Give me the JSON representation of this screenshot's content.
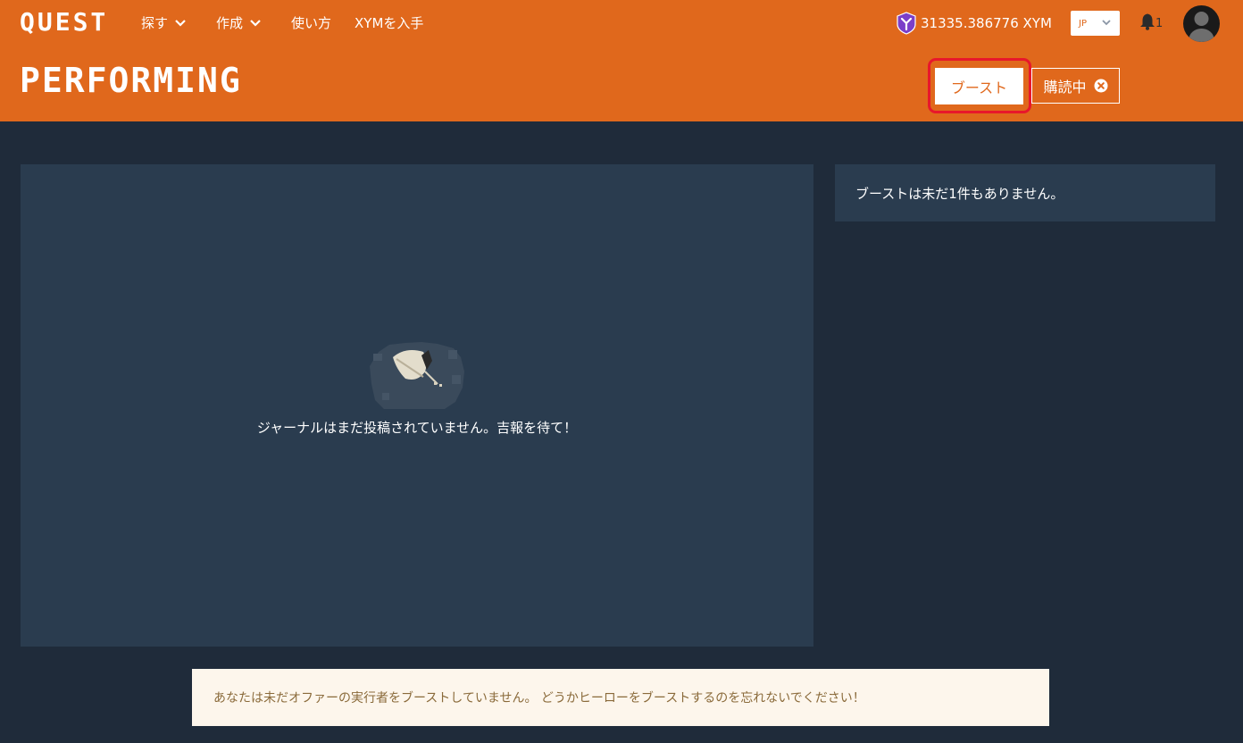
{
  "header": {
    "logo": "QUEST",
    "nav": [
      {
        "label": "探す",
        "has_dropdown": true
      },
      {
        "label": "作成",
        "has_dropdown": true
      },
      {
        "label": "使い方",
        "has_dropdown": false
      },
      {
        "label": "XYMを入手",
        "has_dropdown": false
      }
    ],
    "balance": "31335.386776 XYM",
    "language": "JP",
    "notifications_count": "1",
    "page_title": "PERFORMING",
    "boost_label": "ブースト",
    "subscribe_label": "購読中"
  },
  "journal": {
    "empty_message": "ジャーナルはまだ投稿されていません。吉報を待て！"
  },
  "boosts": {
    "empty_message": "ブーストは未だ1件もありません。"
  },
  "notice": {
    "message": "あなたは未だオファーの実行者をブーストしていません。 どうかヒーローをブーストするのを忘れないでください！"
  },
  "colors": {
    "header_bg": "#e0681c",
    "page_bg": "#1f2b3a",
    "panel_bg": "#2a3c4f",
    "highlight": "#e8172b",
    "notice_bg": "#fdf6ec",
    "xym_purple": "#7b3fc9"
  },
  "icons": [
    "chevron-down-icon",
    "xym-icon",
    "bell-icon",
    "avatar-icon",
    "close-circle-icon",
    "feather-quill-icon"
  ]
}
